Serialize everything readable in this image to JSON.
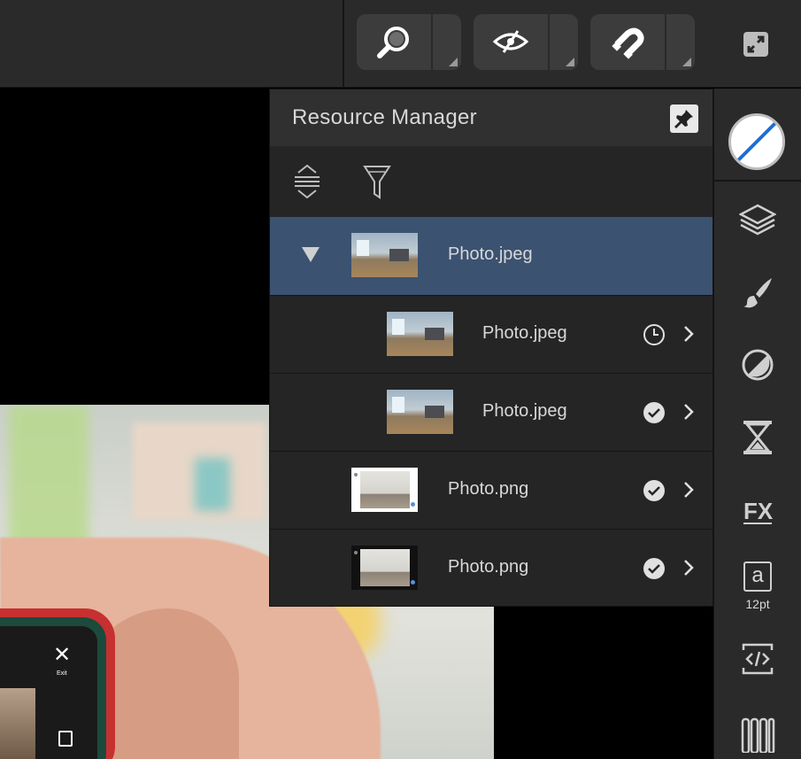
{
  "toolbar": {
    "buttons": [
      {
        "icon": "zoom-icon"
      },
      {
        "icon": "view-mode-icon"
      },
      {
        "icon": "snapping-icon"
      }
    ],
    "expand_icon": "expand-icon"
  },
  "canvas": {
    "phone_exit_label": "Exit",
    "phone_close_glyph": "✕"
  },
  "resource_manager": {
    "title": "Resource Manager",
    "pin_icon": "pin-icon",
    "tools": [
      "sort-icon",
      "filter-icon"
    ],
    "items": [
      {
        "name": "Photo.jpeg",
        "level": 0,
        "selected": true,
        "expanded": true,
        "status": ""
      },
      {
        "name": "Photo.jpeg",
        "level": 1,
        "selected": false,
        "status": "clock"
      },
      {
        "name": "Photo.jpeg",
        "level": 1,
        "selected": false,
        "status": "check"
      },
      {
        "name": "Photo.png",
        "level": 0,
        "selected": false,
        "status": "check"
      },
      {
        "name": "Photo.png",
        "level": 0,
        "selected": false,
        "status": "check"
      }
    ]
  },
  "sidebar": {
    "font_letter": "a",
    "font_size": "12pt",
    "icons": [
      "color-well-icon",
      "layers-icon",
      "brushes-icon",
      "adjustments-icon",
      "hourglass-icon",
      "fx-icon",
      "character-icon",
      "code-icon",
      "swatches-icon"
    ]
  },
  "colors": {
    "toolbar_bg": "#2a2a2a",
    "panel_bg": "#252525",
    "selection": "#3b5271",
    "accent_blue": "#1f6fd1"
  }
}
